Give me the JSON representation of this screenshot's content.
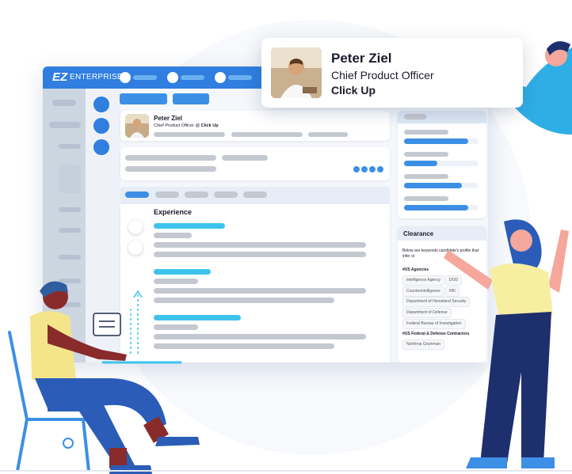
{
  "app": {
    "brand_logo": "EZ",
    "brand_name": "ENTERPRISE"
  },
  "profile_popup": {
    "name": "Peter Ziel",
    "title": "Chief Product Officer",
    "company": "Click Up"
  },
  "profile_card": {
    "name": "Peter Ziel",
    "title_line": "Chief Product Officer @ ",
    "company": "Click Up"
  },
  "experience": {
    "heading": "Experience"
  },
  "clearance": {
    "heading": "Clearance",
    "description": "Below are keywords  candidate's profile that infer st",
    "section1_title": "#US Agencies",
    "section1_tags": [
      "Intelligence Agency",
      "DOD",
      "Counterintelligence",
      "FBI",
      "Department of Homeland Security",
      "Department of Defense",
      "Federal Bureau of Investigation"
    ],
    "section2_title": "#US Federal & Defense Contractors",
    "section2_tags": [
      "Northrop Grumman"
    ]
  },
  "skill_bars": [
    0.86,
    0.45,
    0.78,
    0.86
  ],
  "colors": {
    "primary": "#2f7ee0",
    "accent_cyan": "#3ec3ec",
    "placeholder_gray": "#c4c8d0"
  }
}
